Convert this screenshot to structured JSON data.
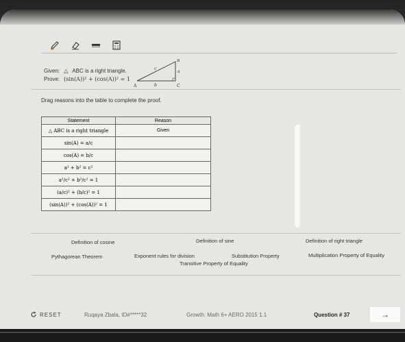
{
  "toolbar": {
    "tools": [
      "pencil-icon",
      "eraser-icon",
      "highlighter-icon",
      "calculator-icon"
    ]
  },
  "given": {
    "given_label": "Given:",
    "given_text": "ABC is a right triangle.",
    "prove_label": "Prove:",
    "prove_text": "(sin(A))² + (cos(A))² = 1",
    "triangle": {
      "A": "A",
      "B": "B",
      "C": "C",
      "a": "a",
      "b": "b",
      "c": "c"
    }
  },
  "instruction": "Drag reasons into the table to complete the proof.",
  "table": {
    "headers": [
      "Statement",
      "Reason"
    ],
    "rows": [
      {
        "statement": "△ ABC is a right triangle",
        "reason": "Given"
      },
      {
        "statement": "sin(A) = a/c",
        "reason": ""
      },
      {
        "statement": "cos(A) = b/c",
        "reason": ""
      },
      {
        "statement": "a² + b² = c²",
        "reason": ""
      },
      {
        "statement": "a²/c² + b²/c² = 1",
        "reason": ""
      },
      {
        "statement": "(a/c)² + (b/c)² = 1",
        "reason": ""
      },
      {
        "statement": "(sin(A))² + (cos(A))² = 1",
        "reason": ""
      }
    ]
  },
  "reason_bank": [
    "Definition of cosine",
    "Definition of sine",
    "Definition of right triangle",
    "Pythagorean Theorem",
    "Exponent rules for division",
    "Substitution Property",
    "Multiplication Property of Equality",
    "Transitive Property of Equality"
  ],
  "footer": {
    "reset_label": "RESET",
    "student": "Ruqaya Zbala, ID#*****32",
    "course": "Growth: Math 6+ AERO 2015 1.1",
    "question": "Question # 37",
    "next_icon": "arrow-right-icon"
  }
}
